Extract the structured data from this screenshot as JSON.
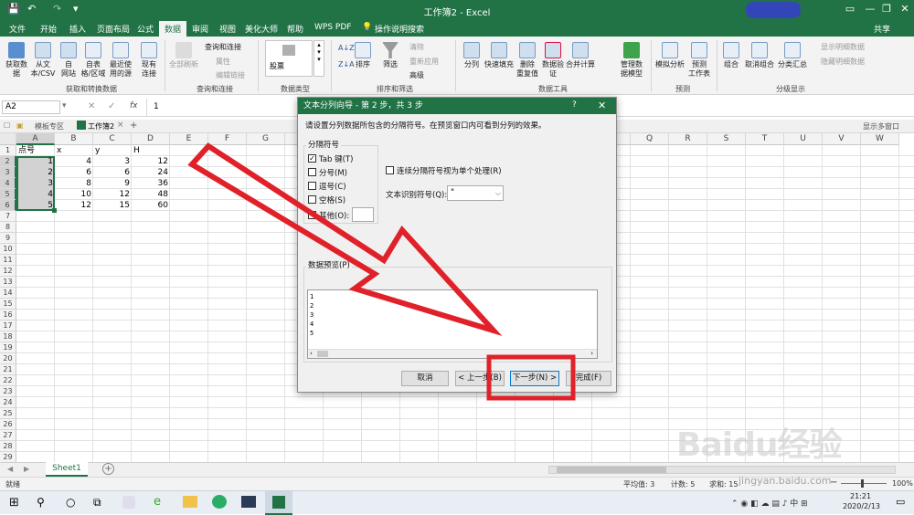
{
  "window": {
    "title": "工作簿2 - Excel",
    "user": "共享"
  },
  "tabs": [
    "文件",
    "开始",
    "插入",
    "页面布局",
    "公式",
    "数据",
    "审阅",
    "视图",
    "美化大师",
    "帮助",
    "WPS PDF",
    "操作说明搜索"
  ],
  "active_tab": "数据",
  "ribbon": {
    "get_data": [
      "获取数\n据",
      "从文\n本/CSV",
      "自\n网站",
      "自表\n格/区域",
      "最近使\n用的源",
      "现有\n连接"
    ],
    "get_data_group": "获取和转换数据",
    "refresh_all": "全部刷新",
    "queries": [
      "查询和连接",
      "属性",
      "编辑链接"
    ],
    "queries_group": "查询和连接",
    "data_type": "股票",
    "data_type_group": "数据类型",
    "sort_az": "排序",
    "filter": "筛选",
    "filter_opts": [
      "清除",
      "重新应用",
      "高级"
    ],
    "sort_group": "排序和筛选",
    "tools": [
      "分列",
      "快速填充",
      "删除\n重复值",
      "数据验\n证",
      "合并计算",
      "管理数\n据模型"
    ],
    "tools_group": "数据工具",
    "forecast": [
      "模拟分析",
      "预测\n工作表"
    ],
    "forecast_group": "预测",
    "outline": [
      "组合",
      "取消组合",
      "分类汇总"
    ],
    "outline_opts": [
      "显示明细数据",
      "隐藏明细数据"
    ],
    "outline_group": "分级显示"
  },
  "formula_bar": {
    "name_box": "A2",
    "formula": "1"
  },
  "workbook_tabs": {
    "template": "模板专区",
    "book": "工作簿2",
    "multi_window": "显示多窗口"
  },
  "columns": [
    "A",
    "B",
    "C",
    "D",
    "E",
    "F",
    "G",
    "H",
    "I",
    "J",
    "K",
    "L",
    "M",
    "N",
    "O",
    "P",
    "Q",
    "R",
    "S",
    "T",
    "U",
    "V",
    "W"
  ],
  "rows": [
    "1",
    "2",
    "3",
    "4",
    "5",
    "6",
    "7",
    "8",
    "9",
    "10",
    "11",
    "12",
    "13",
    "14",
    "15",
    "16",
    "17",
    "18",
    "19",
    "20",
    "21",
    "22",
    "23",
    "24",
    "25",
    "26",
    "27",
    "28",
    "29"
  ],
  "table": {
    "header": [
      "点号",
      "x",
      "y",
      "H"
    ],
    "data": [
      [
        "1",
        "4",
        "3",
        "12"
      ],
      [
        "2",
        "6",
        "6",
        "24"
      ],
      [
        "3",
        "8",
        "9",
        "36"
      ],
      [
        "4",
        "10",
        "12",
        "48"
      ],
      [
        "5",
        "12",
        "15",
        "60"
      ]
    ]
  },
  "sheet_tab": "Sheet1",
  "status": {
    "mode": "就绪",
    "average": "平均值: 3",
    "count": "计数: 5",
    "sum": "求和: 15",
    "zoom": "100%"
  },
  "taskbar": {
    "time": "21:21",
    "date": "2020/2/13"
  },
  "dialog": {
    "title": "文本分列向导 - 第 2 步，共 3 步",
    "help": "?",
    "instruction": "请设置分列数据所包含的分隔符号。在预览窗口内可看到分列的效果。",
    "delimiters_label": "分隔符号",
    "delimiters": [
      {
        "label": "Tab 键(T)",
        "checked": true
      },
      {
        "label": "分号(M)",
        "checked": false
      },
      {
        "label": "逗号(C)",
        "checked": false
      },
      {
        "label": "空格(S)",
        "checked": false
      },
      {
        "label": "其他(O):",
        "checked": false
      }
    ],
    "consecutive_label": "连续分隔符号视为单个处理(R)",
    "qualifier_label": "文本识别符号(Q):",
    "qualifier_value": "\"",
    "preview_label": "数据预览(P)",
    "preview_lines": [
      "1",
      "2",
      "3",
      "4",
      "5"
    ],
    "buttons": {
      "cancel": "取消",
      "back": "< 上一步(B)",
      "next": "下一步(N) >",
      "finish": "完成(F)"
    }
  },
  "watermark": "Baidu经验",
  "watermark_url": "jingyan.baidu.com",
  "colors": {
    "excel_green": "#217346",
    "annotation_red": "#e0212a"
  }
}
